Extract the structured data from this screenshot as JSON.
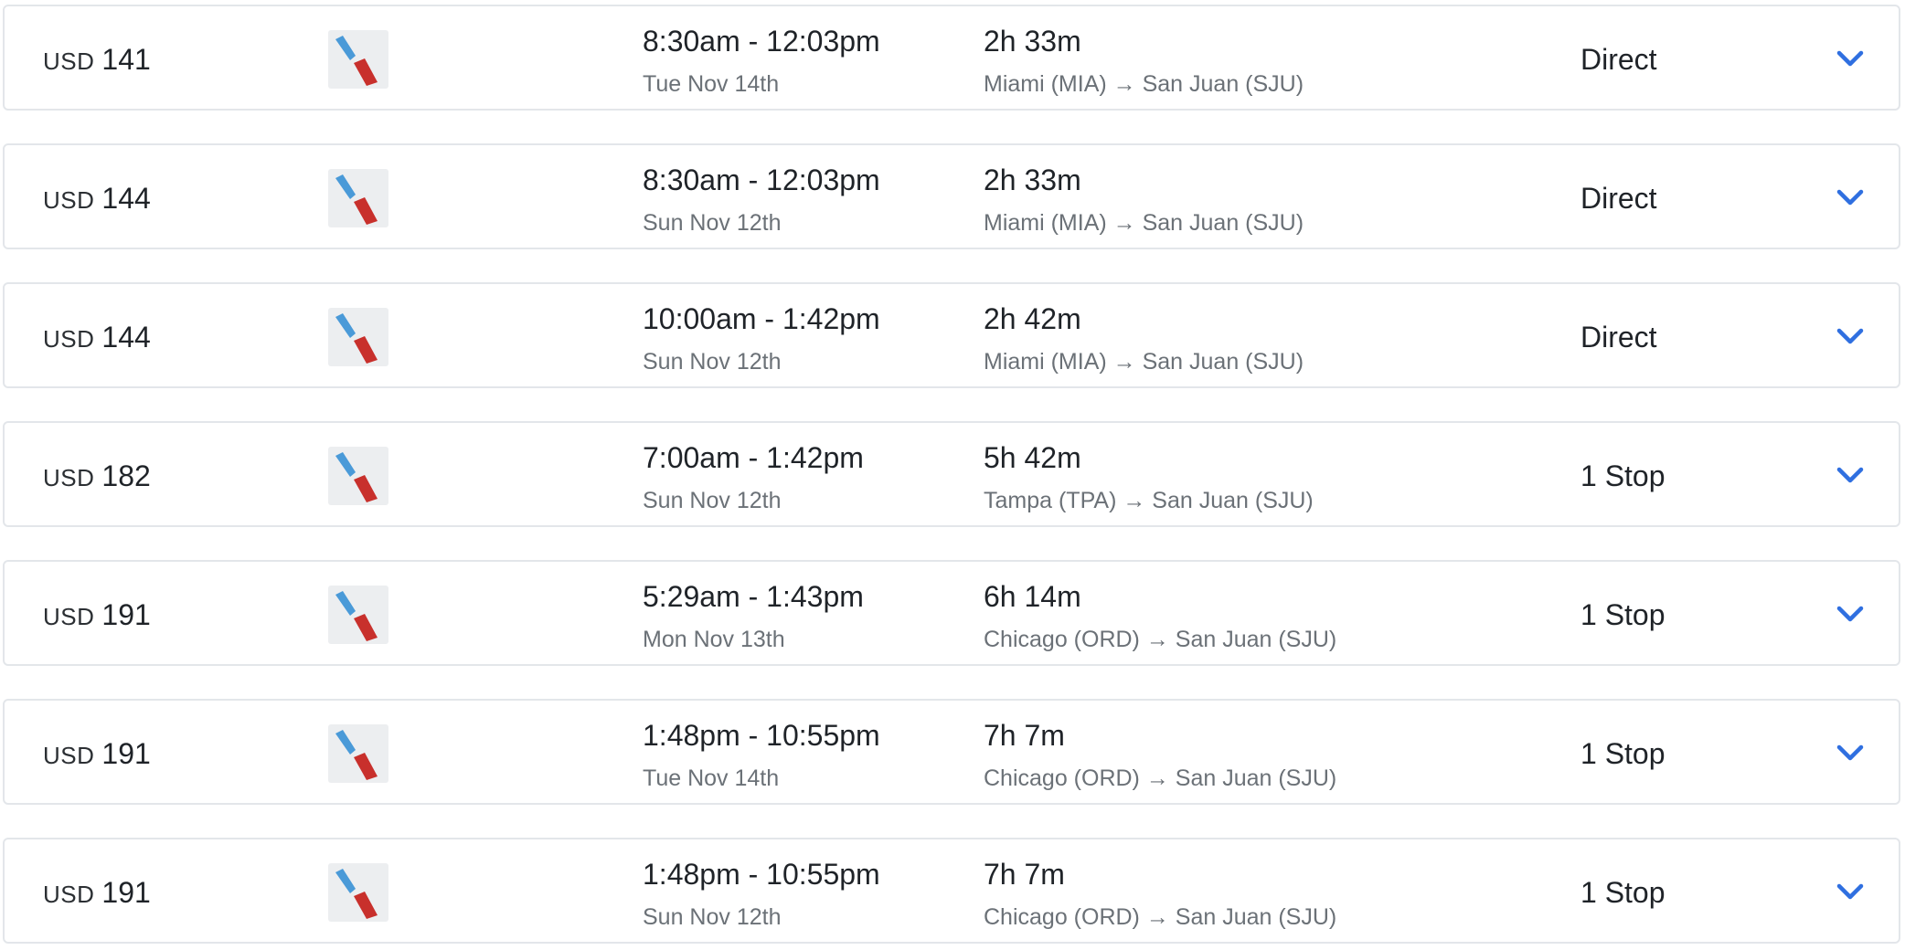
{
  "flights": [
    {
      "currency": "USD",
      "amount": "141",
      "times": "8:30am - 12:03pm",
      "date": "Tue Nov 14th",
      "duration": "2h 33m",
      "route": "Miami (MIA) → San Juan (SJU)",
      "stops": "Direct",
      "airline_logo": "american-airlines-logo",
      "expand_icon": "chevron-down-icon"
    },
    {
      "currency": "USD",
      "amount": "144",
      "times": "8:30am - 12:03pm",
      "date": "Sun Nov 12th",
      "duration": "2h 33m",
      "route": "Miami (MIA) → San Juan (SJU)",
      "stops": "Direct",
      "airline_logo": "american-airlines-logo",
      "expand_icon": "chevron-down-icon"
    },
    {
      "currency": "USD",
      "amount": "144",
      "times": "10:00am - 1:42pm",
      "date": "Sun Nov 12th",
      "duration": "2h 42m",
      "route": "Miami (MIA) → San Juan (SJU)",
      "stops": "Direct",
      "airline_logo": "american-airlines-logo",
      "expand_icon": "chevron-down-icon"
    },
    {
      "currency": "USD",
      "amount": "182",
      "times": "7:00am - 1:42pm",
      "date": "Sun Nov 12th",
      "duration": "5h 42m",
      "route": "Tampa (TPA) → San Juan (SJU)",
      "stops": "1 Stop",
      "airline_logo": "american-airlines-logo",
      "expand_icon": "chevron-down-icon"
    },
    {
      "currency": "USD",
      "amount": "191",
      "times": "5:29am - 1:43pm",
      "date": "Mon Nov 13th",
      "duration": "6h 14m",
      "route": "Chicago (ORD) → San Juan (SJU)",
      "stops": "1 Stop",
      "airline_logo": "american-airlines-logo",
      "expand_icon": "chevron-down-icon"
    },
    {
      "currency": "USD",
      "amount": "191",
      "times": "1:48pm - 10:55pm",
      "date": "Tue Nov 14th",
      "duration": "7h 7m",
      "route": "Chicago (ORD) → San Juan (SJU)",
      "stops": "1 Stop",
      "airline_logo": "american-airlines-logo",
      "expand_icon": "chevron-down-icon"
    },
    {
      "currency": "USD",
      "amount": "191",
      "times": "1:48pm - 10:55pm",
      "date": "Sun Nov 12th",
      "duration": "7h 7m",
      "route": "Chicago (ORD) → San Juan (SJU)",
      "stops": "1 Stop",
      "airline_logo": "american-airlines-logo",
      "expand_icon": "chevron-down-icon"
    }
  ],
  "colors": {
    "row_border": "#e3e6ea",
    "secondary_text": "#6b7177",
    "chevron": "#2f6fe0",
    "logo_red": "#c8302c",
    "logo_blue": "#4a9ad8",
    "logo_background": "#eceef0"
  }
}
